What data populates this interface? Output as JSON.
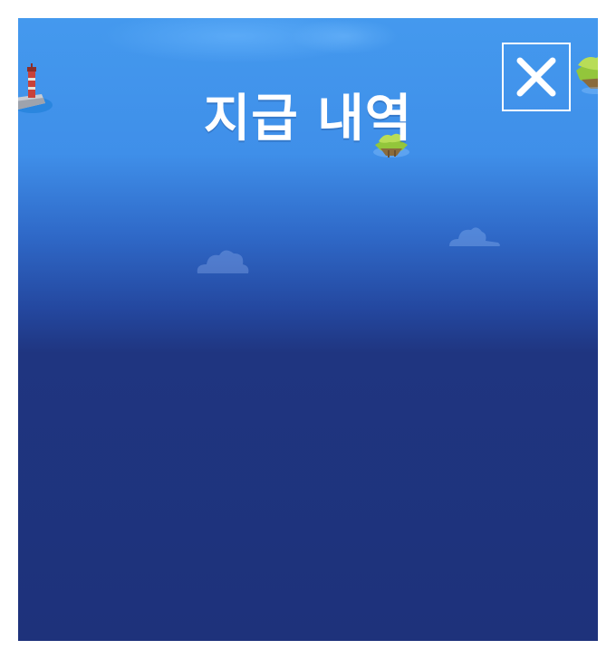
{
  "header": {
    "title": "지급 내역",
    "close_icon": "close-icon"
  },
  "colors": {
    "sky_top": "#4499ee",
    "sky_bottom": "#1e327b",
    "title_text": "#ffffff"
  },
  "decorations": [
    "lighthouse-icon",
    "floating-island-icon",
    "cloud-icon"
  ]
}
